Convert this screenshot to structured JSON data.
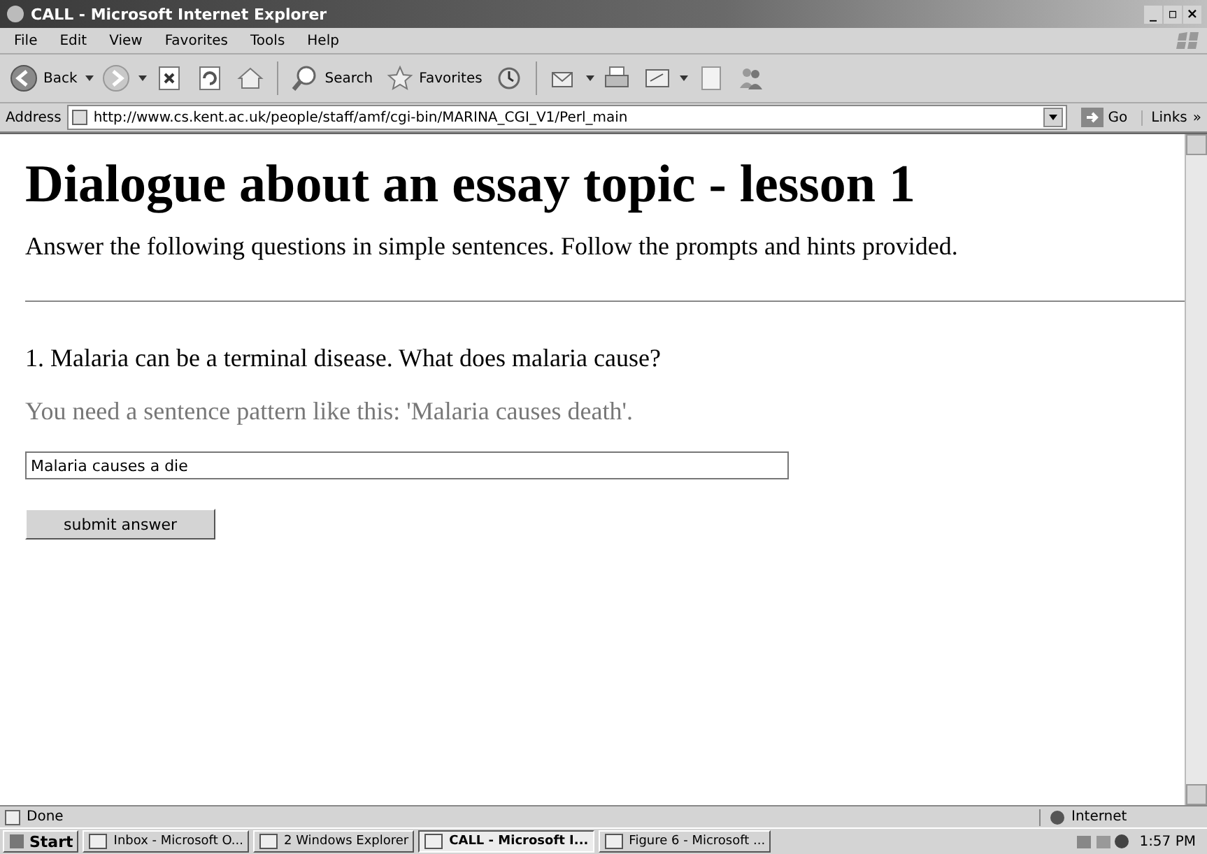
{
  "window": {
    "title": "CALL - Microsoft Internet Explorer",
    "controls": [
      "_",
      "▫",
      "×"
    ]
  },
  "menu": [
    "File",
    "Edit",
    "View",
    "Favorites",
    "Tools",
    "Help"
  ],
  "toolbar": [
    {
      "kind": "back",
      "label": "Back"
    },
    {
      "kind": "forward"
    },
    {
      "kind": "stop"
    },
    {
      "kind": "refresh"
    },
    {
      "kind": "home"
    },
    {
      "kind": "search",
      "label": "Search"
    },
    {
      "kind": "favorites",
      "label": "Favorites"
    },
    {
      "kind": "history"
    },
    {
      "kind": "mail"
    },
    {
      "kind": "print"
    },
    {
      "kind": "edit"
    },
    {
      "kind": "blank"
    },
    {
      "kind": "people"
    }
  ],
  "address": {
    "label": "Address",
    "url": "http://www.cs.kent.ac.uk/people/staff/amf/cgi-bin/MARINA_CGI_V1/Perl_main",
    "go": "Go",
    "links": "Links",
    "more": "»"
  },
  "page": {
    "heading": "Dialogue about an essay topic - lesson 1",
    "intro": "Answer the following questions in simple sentences. Follow the prompts and hints provided.",
    "question": "1. Malaria can be a terminal disease. What does malaria cause?",
    "hint": "You need a sentence pattern like this: 'Malaria causes death'.",
    "answer": {
      "value": "Malaria causes a die"
    },
    "submit": "submit answer"
  },
  "status_bar": {
    "text": "Done",
    "zone": "Internet"
  },
  "taskbar": {
    "start": "Start",
    "tasks": [
      {
        "label": "Inbox - Microsoft O...",
        "selected": false
      },
      {
        "label": "2 Windows Explorer",
        "selected": false
      },
      {
        "label": "CALL - Microsoft I...",
        "selected": true
      },
      {
        "label": "Figure 6 - Microsoft ...",
        "selected": false
      }
    ],
    "clock": "1:57 PM"
  }
}
